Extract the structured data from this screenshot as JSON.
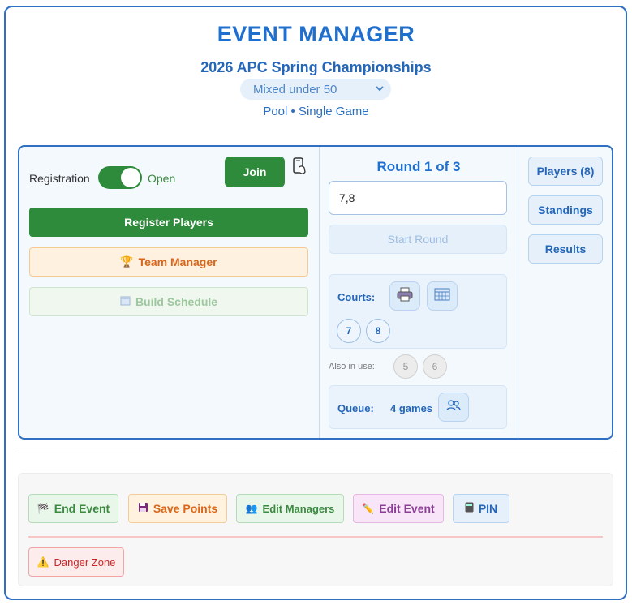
{
  "header": {
    "title": "EVENT MANAGER",
    "event_name": "2026 APC Spring Championships",
    "division": "Mixed under 50",
    "format": "Pool • Single Game"
  },
  "registration": {
    "label": "Registration",
    "status": "Open",
    "join_label": "Join",
    "register_label": "Register Players",
    "team_manager_label": "Team Manager",
    "build_schedule_label": "Build Schedule"
  },
  "round": {
    "title": "Round 1 of 3",
    "input_value": "7,8",
    "start_label": "Start Round",
    "courts_label": "Courts:",
    "courts": [
      "7",
      "8"
    ],
    "also_label": "Also in use:",
    "also_in_use": [
      "5",
      "6"
    ],
    "queue_label": "Queue:",
    "queue_count": "4 games"
  },
  "side": {
    "players_label": "Players (8)",
    "standings_label": "Standings",
    "results_label": "Results"
  },
  "footer": {
    "end_event_label": "End Event",
    "save_points_label": "Save Points",
    "edit_managers_label": "Edit Managers",
    "edit_event_label": "Edit Event",
    "pin_label": "PIN",
    "danger_label": "Danger Zone"
  },
  "icons": {
    "phone": "phone-icon",
    "printer": "printer-icon",
    "grid": "grid-icon",
    "people": "people-icon"
  },
  "colors": {
    "accent": "#1f6fcf",
    "success": "#2e8b3b",
    "warning": "#d9661a",
    "danger": "#c62828"
  }
}
